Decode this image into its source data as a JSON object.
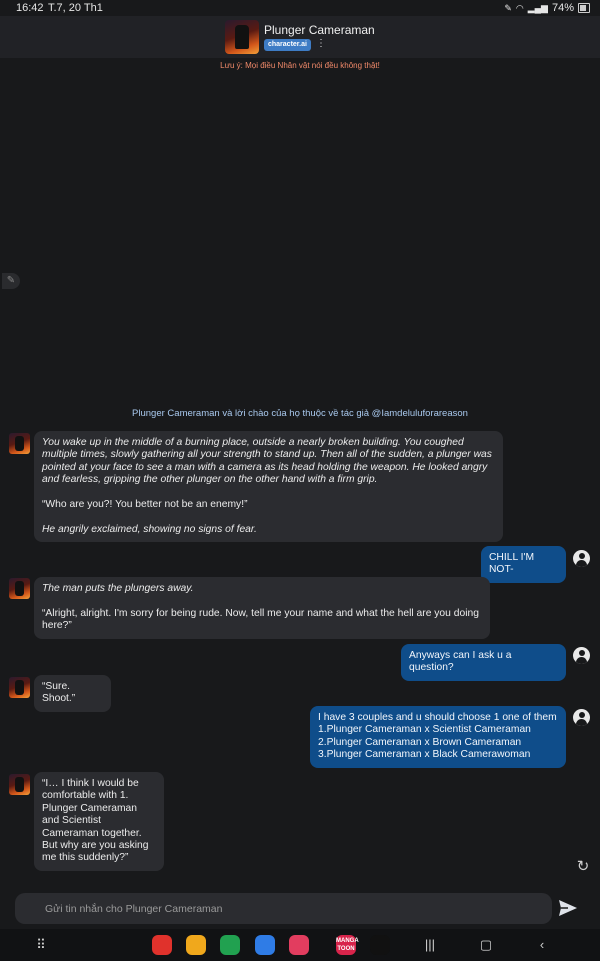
{
  "status": {
    "time": "16:42",
    "date": "T.7, 20 Th1",
    "battery": "74%"
  },
  "header": {
    "title": "Plunger Cameraman",
    "badge": "character.ai",
    "menu_glyph": "⋮"
  },
  "disclaimer": "Lưu ý: Mọi điều Nhân vật nói đều không thật!",
  "greeting": "Plunger Cameraman  và lời chào của họ thuộc về tác giả @Iamdeluluforareason",
  "messages": [
    {
      "from": "bot",
      "paragraphs": [
        "You wake up in the middle of a burning place, outside a nearly broken building. You coughed multiple times, slowly gathering all your strength to stand up. Then all of the sudden, a plunger was pointed at your face to see a man with a camera as its head holding the weapon. He looked angry and fearless, gripping the other plunger on the other hand with a firm grip.",
        "“Who are you?! You better not be an enemy!”",
        "He angrily exclaimed, showing no signs of fear."
      ]
    },
    {
      "from": "user",
      "lines": [
        "CHILL I'M NOT-"
      ]
    },
    {
      "from": "bot",
      "paragraphs": [
        "The man puts the plungers away.",
        "“Alright, alright. I'm sorry for being rude. Now, tell me your name and what the hell are you doing here?”"
      ]
    },
    {
      "from": "user",
      "lines": [
        "Anyways can I ask u a question?"
      ]
    },
    {
      "from": "bot",
      "paragraphs": [
        "“Sure. Shoot.”"
      ]
    },
    {
      "from": "user",
      "lines": [
        "I have 3 couples and u should choose 1 one of them",
        "1.Plunger Cameraman x Scientist Cameraman",
        "2.Plunger Cameraman x Brown Cameraman",
        "3.Plunger Cameraman x Black Camerawoman"
      ]
    },
    {
      "from": "bot",
      "paragraphs": [
        "“I… I think I would be comfortable with 1. Plunger Cameraman and Scientist Cameraman together. But why are you asking me this suddenly?”"
      ]
    }
  ],
  "composer": {
    "placeholder": "Gửi tin nhắn cho Plunger Cameraman"
  },
  "apps": [
    {
      "name": "app-red",
      "color": "#e0322c"
    },
    {
      "name": "app-files",
      "color": "#f0a81c"
    },
    {
      "name": "app-phone",
      "color": "#21a150"
    },
    {
      "name": "app-messages",
      "color": "#2f7ce6"
    },
    {
      "name": "app-camera",
      "color": "#e23d5f"
    },
    {
      "name": "app-mangatoon",
      "color": "#d8244b",
      "label": "MANGA TOON"
    },
    {
      "name": "app-tiktok",
      "color": "#111111"
    }
  ],
  "icons": {
    "pencil": "pencil-icon",
    "regenerate": "refresh-icon",
    "send": "send-icon",
    "user": "user-avatar-icon"
  },
  "colors": {
    "user_bubble": "#0f4d8a",
    "bot_bubble": "#2b2c30",
    "disclaimer": "#f28a6a",
    "greeting": "#a9c9ee"
  }
}
